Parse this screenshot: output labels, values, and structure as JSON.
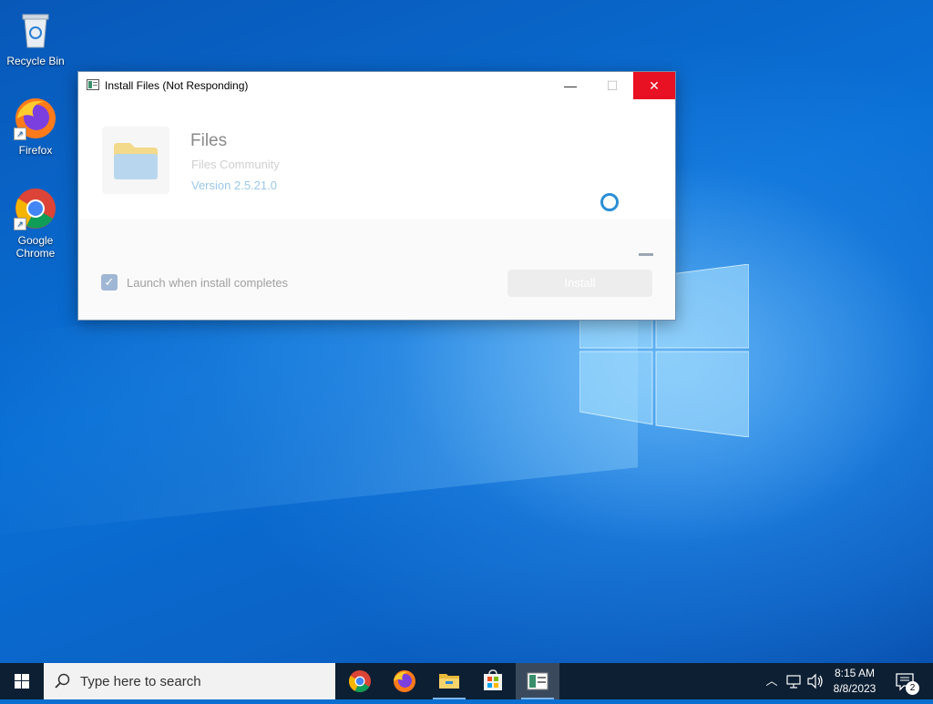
{
  "desktop": {
    "icons": [
      {
        "label": "Recycle Bin"
      },
      {
        "label": "Firefox"
      },
      {
        "label": "Google Chrome"
      }
    ]
  },
  "window": {
    "title": "Install Files (Not Responding)",
    "app_name": "Files",
    "publisher": "Files Community",
    "version": "Version 2.5.21.0",
    "launch_checkbox": {
      "label": "Launch when install completes",
      "checked": true
    },
    "install_button": "Install",
    "controls": {
      "minimize": "minimize-icon",
      "maximize": "maximize-icon",
      "close": "close-icon"
    }
  },
  "taskbar": {
    "search_placeholder": "Type here to search",
    "pinned_apps": [
      "chrome-icon",
      "firefox-icon",
      "file-explorer-icon",
      "store-icon",
      "installer-icon"
    ],
    "clock": {
      "time": "8:15 AM",
      "date": "8/8/2023"
    },
    "notification_count": "2"
  },
  "colors": {
    "accent": "#0078d7",
    "close_red": "#e81123",
    "taskbar": "#0d1f33"
  }
}
